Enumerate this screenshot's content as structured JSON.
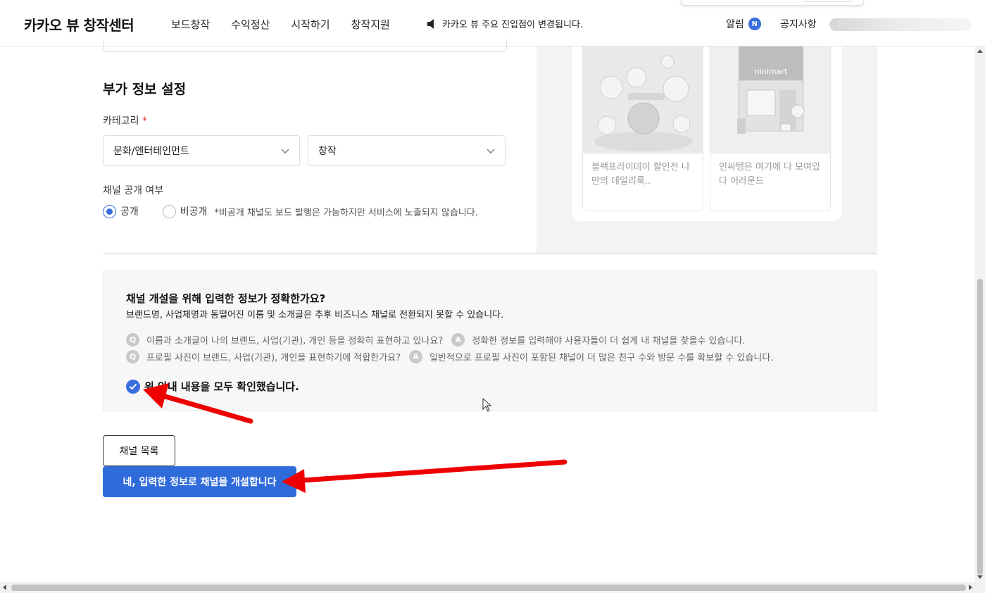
{
  "header": {
    "logo": "카카오 뷰 창작센터",
    "nav": [
      "보드창작",
      "수익정산",
      "시작하기",
      "창작지원"
    ],
    "notice": "카카오 뷰 주요 진입점이 변경됩니다.",
    "alarm_label": "알림",
    "alarm_badge": "N",
    "notice_board": "공지사항"
  },
  "extra_settings": {
    "title": "부가 정보 설정",
    "category_label": "카테고리",
    "required_mark": "*",
    "category_primary": "문화/엔터테인먼트",
    "category_secondary": "창작",
    "visibility_label": "채널 공개 여부",
    "visibility_public": "공개",
    "visibility_private": "비공개",
    "visibility_note": "*비공개 채널도 보드 발행은 가능하지만 서비스에 노출되지 않습니다."
  },
  "preview": {
    "cards": [
      {
        "text": "블랙프라이데이 할인전 나만의 데일리룩..",
        "thumb_label": ""
      },
      {
        "text": "인싸템은 여기에 다 모여있다 어라운드",
        "thumb_label": "ninimart"
      }
    ]
  },
  "confirm": {
    "title": "채널 개설을 위해 입력한 정보가 정확한가요?",
    "subtitle": "브랜드명, 사업체명과 동떨어진 이름 및 소개글은 추후 비즈니스 채널로 전환되지 못할 수 있습니다.",
    "q_badge": "Q",
    "a_badge": "A",
    "qa": [
      {
        "q": "이름과 소개글이 나의 브랜드, 사업(기관), 개인 등을 정확히 표현하고 있나요?",
        "a": "정확한 정보를 입력해야 사용자들이 더 쉽게 내 채널을 찾을수 있습니다."
      },
      {
        "q": "프로필 사진이 브랜드, 사업(기관), 개인을 표현하기에 적합한가요?",
        "a": "일반적으로 프로필 사진이 포함된 채널이 더 많은 친구 수와 방문 수를 확보할 수 있습니다."
      }
    ],
    "check_label": "위 안내 내용을 모두 확인했습니다."
  },
  "buttons": {
    "list": "채널 목록",
    "create": "네, 입력한 정보로 채널을 개설합니다"
  },
  "colors": {
    "accent": "#2f6bdb",
    "arrow": "#ee0000"
  }
}
